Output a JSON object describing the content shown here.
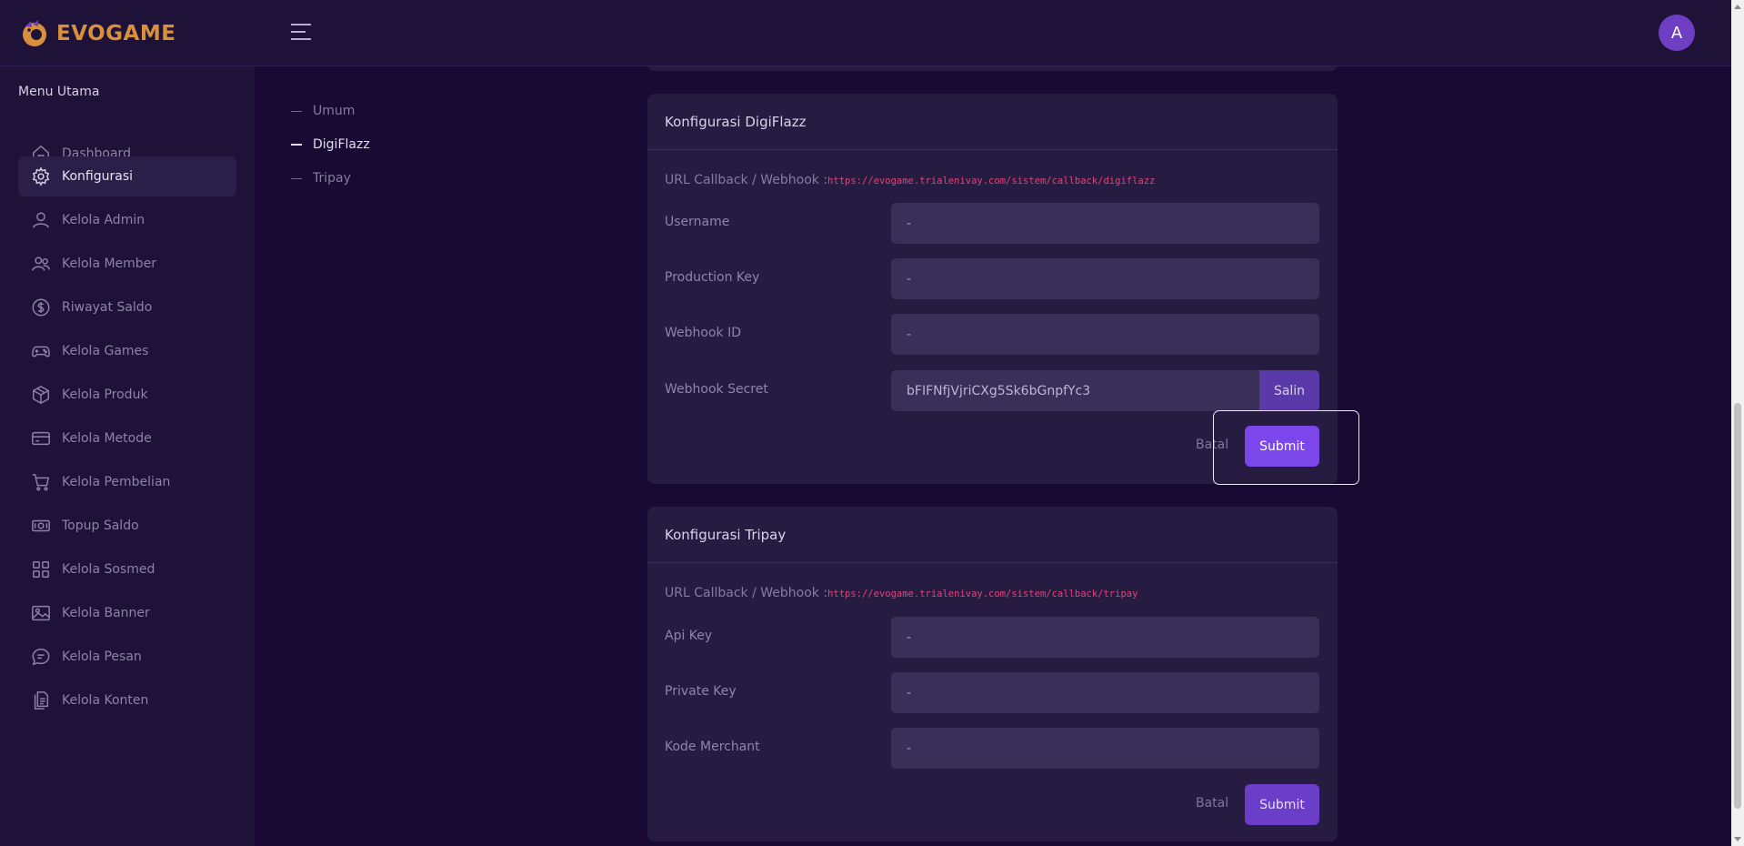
{
  "brand": {
    "name": "EVOGAME",
    "logo_icon": "dragon-logo-icon"
  },
  "header": {
    "avatar_initial": "A",
    "menu_icon": "hamburger-icon"
  },
  "sidebar": {
    "title": "Menu Utama",
    "items": [
      {
        "label": "Dashboard",
        "icon": "home-icon",
        "active": false
      },
      {
        "label": "Konfigurasi",
        "icon": "gear-icon",
        "active": true
      },
      {
        "label": "Kelola Admin",
        "icon": "user-icon",
        "active": false
      },
      {
        "label": "Kelola Member",
        "icon": "users-icon",
        "active": false
      },
      {
        "label": "Riwayat Saldo",
        "icon": "dollar-circle-icon",
        "active": false
      },
      {
        "label": "Kelola Games",
        "icon": "gamepad-icon",
        "active": false
      },
      {
        "label": "Kelola Produk",
        "icon": "box-icon",
        "active": false
      },
      {
        "label": "Kelola Metode",
        "icon": "credit-card-icon",
        "active": false
      },
      {
        "label": "Kelola Pembelian",
        "icon": "cart-icon",
        "active": false
      },
      {
        "label": "Topup Saldo",
        "icon": "money-icon",
        "active": false
      },
      {
        "label": "Kelola Sosmed",
        "icon": "grid-icon",
        "active": false
      },
      {
        "label": "Kelola Banner",
        "icon": "image-icon",
        "active": false
      },
      {
        "label": "Kelola Pesan",
        "icon": "chat-icon",
        "active": false
      },
      {
        "label": "Kelola Konten",
        "icon": "document-icon",
        "active": false
      }
    ]
  },
  "anchor_nav": {
    "items": [
      {
        "label": "Umum",
        "active": false
      },
      {
        "label": "DigiFlazz",
        "active": true
      },
      {
        "label": "Tripay",
        "active": false
      }
    ]
  },
  "digiflazz": {
    "title": "Konfigurasi DigiFlazz",
    "url_label": "URL Callback / Webhook :",
    "url_value": "https://evogame.trialenivay.com/sistem/callback/digiflazz",
    "fields": [
      {
        "label": "Username",
        "value": "-"
      },
      {
        "label": "Production Key",
        "value": "-"
      },
      {
        "label": "Webhook ID",
        "value": "-"
      },
      {
        "label": "Webhook Secret",
        "value": "bFIFNfjVjriCXg5Sk6bGnpfYc3"
      }
    ],
    "copy_label": "Salin",
    "cancel_label": "Batal",
    "submit_label": "Submit"
  },
  "tripay": {
    "title": "Konfigurasi Tripay",
    "url_label": "URL Callback / Webhook :",
    "url_value": "https://evogame.trialenivay.com/sistem/callback/tripay",
    "fields": [
      {
        "label": "Api Key",
        "value": "-"
      },
      {
        "label": "Private Key",
        "value": "-"
      },
      {
        "label": "Kode Merchant",
        "value": "-"
      }
    ],
    "cancel_label": "Batal",
    "submit_label": "Submit"
  },
  "colors": {
    "accent": "#7b46ea",
    "background": "#180a33",
    "panel": "#261b40",
    "url": "#e0457a",
    "brand": "#d8903a"
  }
}
